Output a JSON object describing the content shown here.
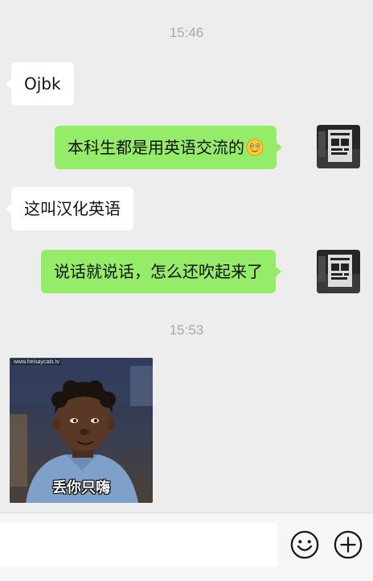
{
  "chat": {
    "timestamp_1": "15:46",
    "timestamp_2": "15:53",
    "messages": [
      {
        "side": "in",
        "text": "Ojbk"
      },
      {
        "side": "out",
        "text": "本科生都是用英语交流的"
      },
      {
        "side": "in",
        "text": "这叫汉化英语"
      },
      {
        "side": "out",
        "text": "说话就说话，怎么还吹起来了"
      }
    ],
    "sticker": {
      "caption": "丢你只嗨",
      "watermark": "www.heisaycats.tv"
    }
  },
  "input_bar": {
    "input_value": "",
    "emoji_button_icon": "smiley-face-icon",
    "more_button_icon": "plus-circle-icon"
  },
  "colors": {
    "background": "#ededed",
    "outgoing_bubble": "#95ec69",
    "incoming_bubble": "#ffffff",
    "timestamp": "#a8a8a8"
  }
}
